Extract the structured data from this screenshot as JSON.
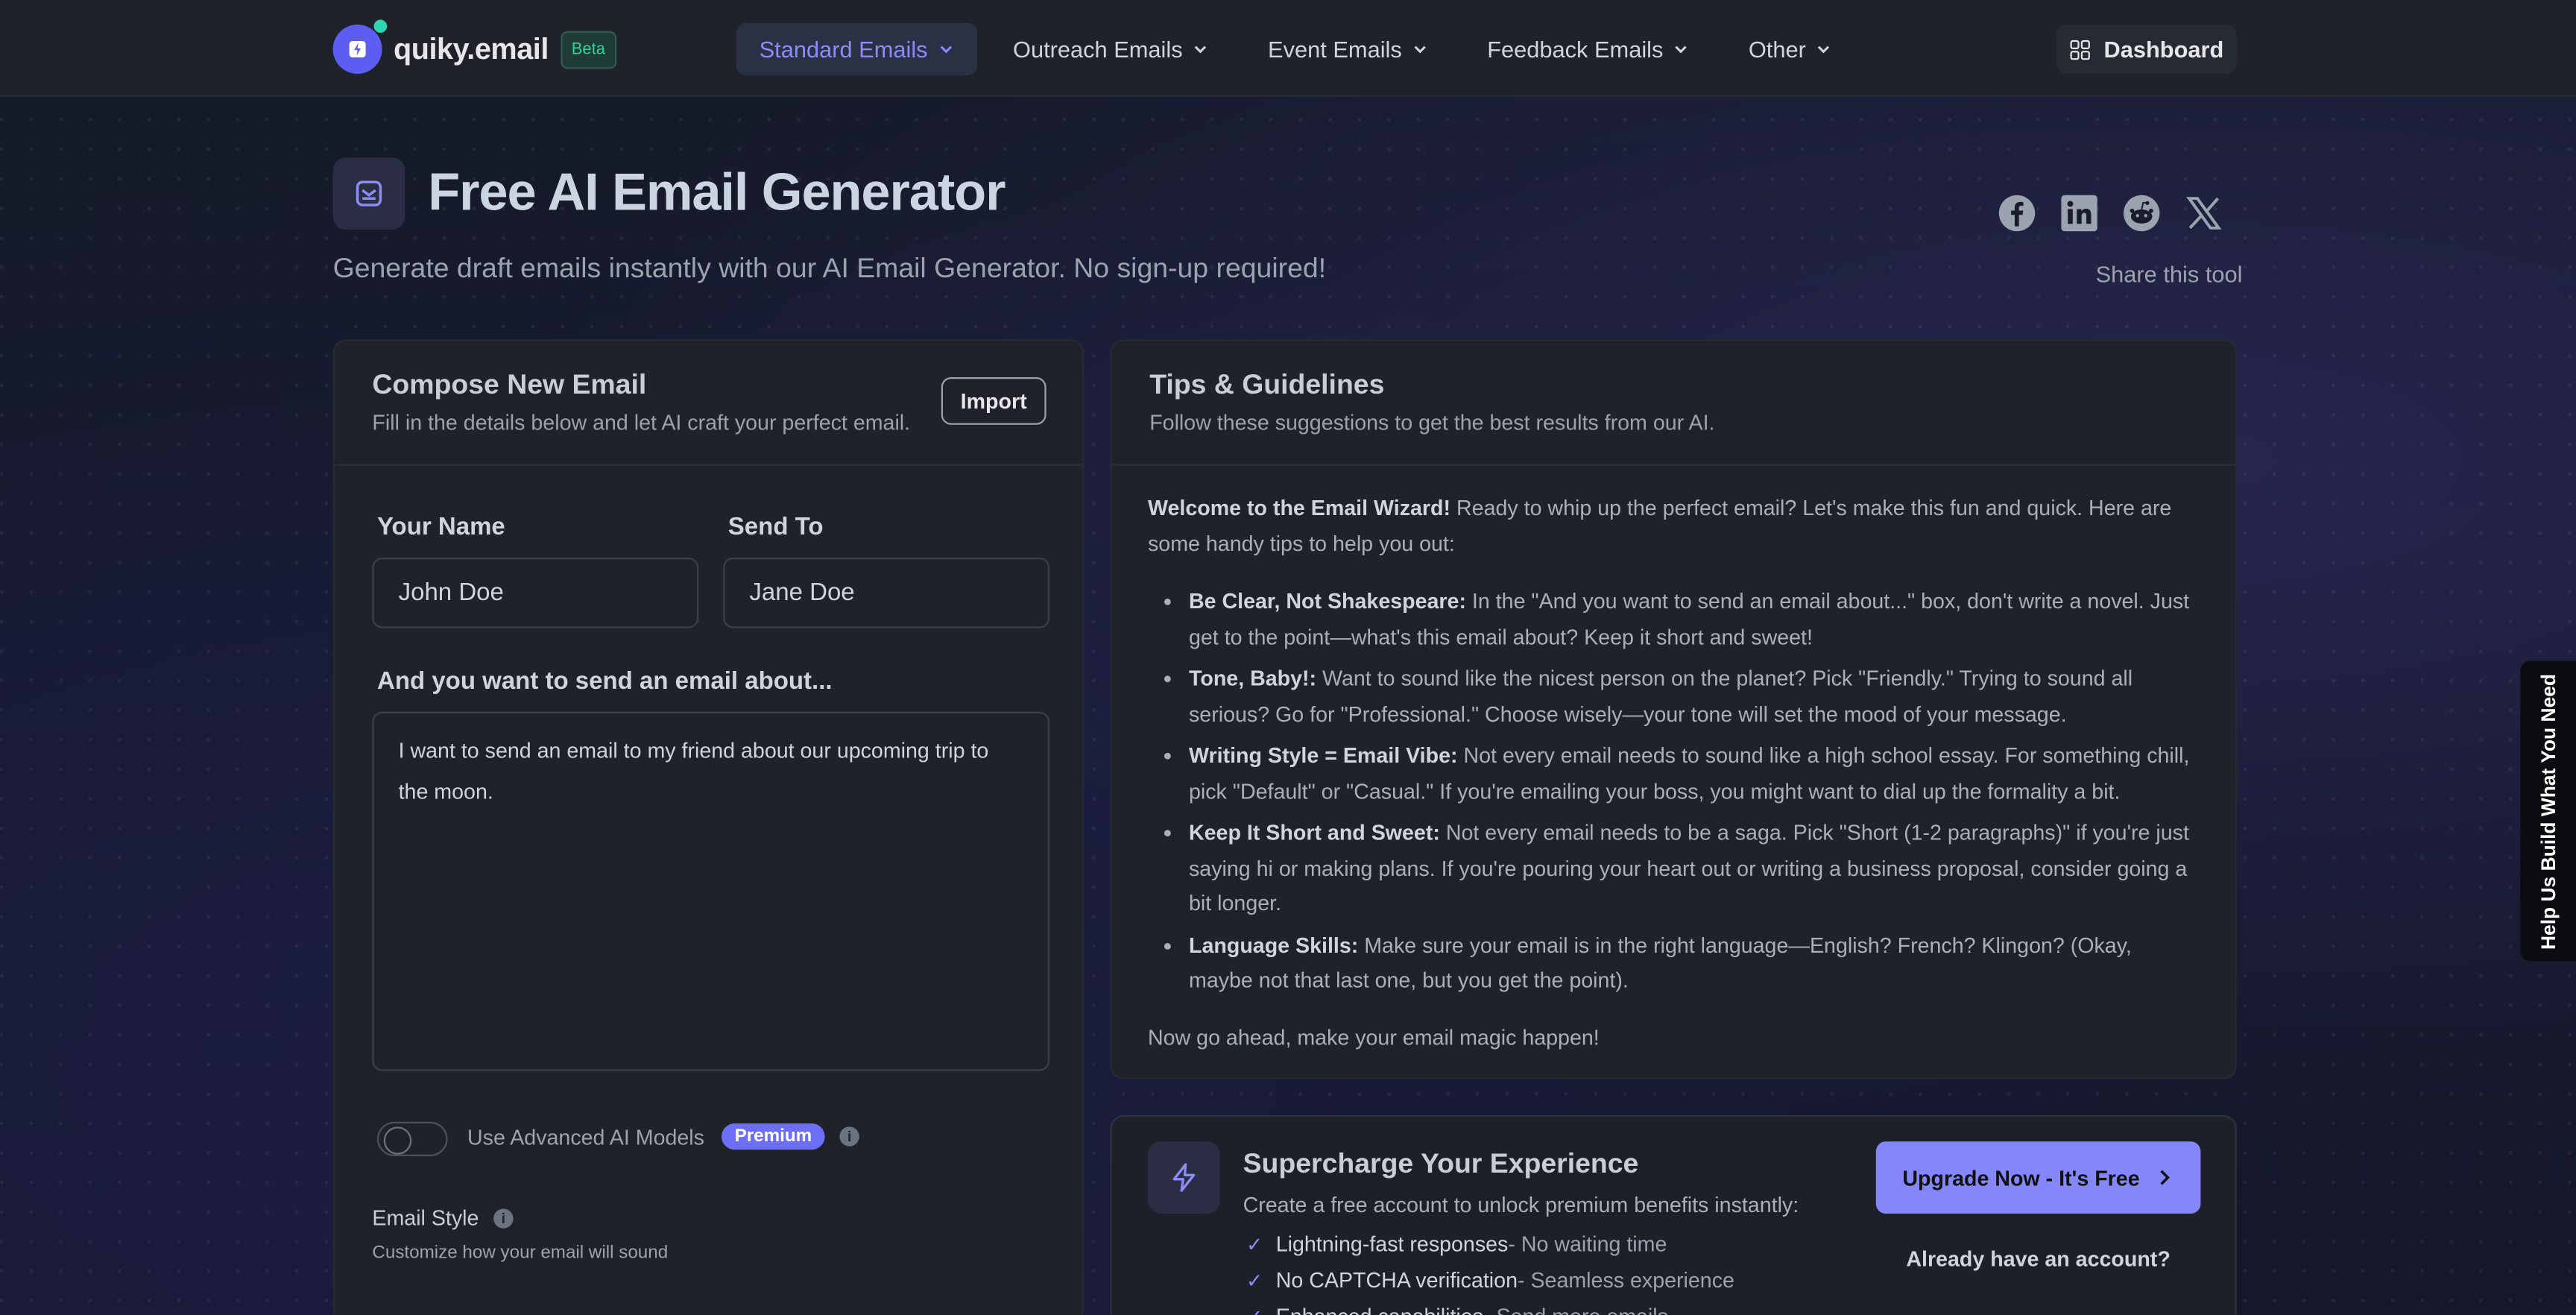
{
  "nav": {
    "brand": "quiky.email",
    "badge": "Beta",
    "menu": [
      {
        "label": "Standard Emails"
      },
      {
        "label": "Outreach Emails"
      },
      {
        "label": "Event Emails"
      },
      {
        "label": "Feedback Emails"
      },
      {
        "label": "Other"
      }
    ],
    "dashboard": "Dashboard"
  },
  "hero": {
    "title": "Free AI Email Generator",
    "subtitle": "Generate draft emails instantly with our AI Email Generator. No sign-up required!",
    "share_label": "Share this tool",
    "share_icons": [
      "facebook-icon",
      "linkedin-icon",
      "reddit-icon",
      "x-icon"
    ]
  },
  "compose": {
    "title": "Compose New Email",
    "subtitle": "Fill in the details below and let AI craft your perfect email.",
    "import": "Import",
    "your_name_label": "Your Name",
    "your_name_value": "John Doe",
    "send_to_label": "Send To",
    "send_to_value": "Jane Doe",
    "about_label": "And you want to send an email about...",
    "about_value": "I want to send an email to my friend about our upcoming trip to the moon.",
    "advanced_label": "Use Advanced AI Models",
    "premium_badge": "Premium",
    "style_label": "Email Style",
    "style_sub": "Customize how your email will sound"
  },
  "tips": {
    "title": "Tips & Guidelines",
    "subtitle": "Follow these suggestions to get the best results from our AI.",
    "intro_bold": "Welcome to the Email Wizard!",
    "intro_rest": " Ready to whip up the perfect email? Let's make this fun and quick. Here are some handy tips to help you out:",
    "items": [
      {
        "bold": "Be Clear, Not Shakespeare:",
        "text": " In the \"And you want to send an email about...\" box, don't write a novel. Just get to the point—what's this email about? Keep it short and sweet!"
      },
      {
        "bold": "Tone, Baby!:",
        "text": " Want to sound like the nicest person on the planet? Pick \"Friendly.\" Trying to sound all serious? Go for \"Professional.\" Choose wisely—your tone will set the mood of your message."
      },
      {
        "bold": "Writing Style = Email Vibe:",
        "text": " Not every email needs to sound like a high school essay. For something chill, pick \"Default\" or \"Casual.\" If you're emailing your boss, you might want to dial up the formality a bit."
      },
      {
        "bold": "Keep It Short and Sweet:",
        "text": " Not every email needs to be a saga. Pick \"Short (1-2 paragraphs)\" if you're just saying hi or making plans. If you're pouring your heart out or writing a business proposal, consider going a bit longer."
      },
      {
        "bold": "Language Skills:",
        "text": " Make sure your email is in the right language—English? French? Klingon? (Okay, maybe not that last one, but you get the point)."
      }
    ],
    "outro": "Now go ahead, make your email magic happen!"
  },
  "supercharge": {
    "title": "Supercharge Your Experience",
    "subtitle": "Create a free account to unlock premium benefits instantly:",
    "benefits": [
      {
        "bold": "Lightning-fast responses",
        "text": " - No waiting time"
      },
      {
        "bold": "No CAPTCHA verification",
        "text": " - Seamless experience"
      },
      {
        "bold": "Enhanced capabilities",
        "text": " - Send more emails"
      }
    ],
    "upgrade": "Upgrade Now - It's Free",
    "already": "Already have an account?"
  },
  "help_tab": "Help Us Build What You Need",
  "colors": {
    "accent": "#8387fa",
    "background": "#121621",
    "card": "#1f2329"
  }
}
